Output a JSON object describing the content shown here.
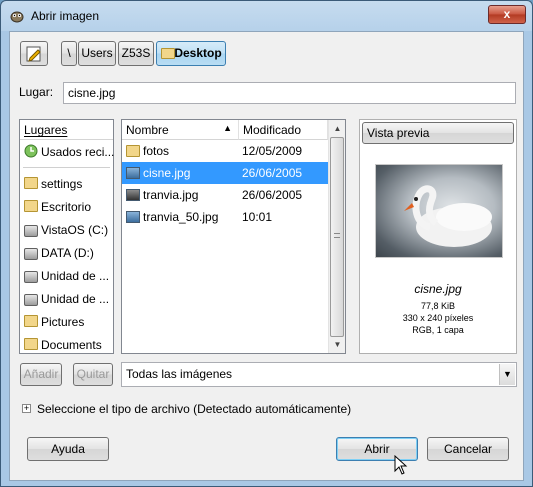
{
  "window": {
    "title": "Abrir imagen",
    "close_glyph": "x"
  },
  "pathbar": {
    "segments": [
      "\\",
      "Users",
      "Z53S",
      "Desktop"
    ]
  },
  "location": {
    "label": "Lugar:",
    "value": "cisne.jpg"
  },
  "places": {
    "header": "Lugares",
    "items": [
      {
        "label": "Usados reci...",
        "icon": "clock-icon"
      },
      {
        "label": "settings",
        "icon": "folder-icon"
      },
      {
        "label": "Escritorio",
        "icon": "folder-icon"
      },
      {
        "label": "VistaOS (C:)",
        "icon": "drive-icon"
      },
      {
        "label": "DATA (D:)",
        "icon": "drive-icon"
      },
      {
        "label": "Unidad de ...",
        "icon": "drive-icon"
      },
      {
        "label": "Unidad de ...",
        "icon": "drive-icon"
      },
      {
        "label": "Pictures",
        "icon": "folder-icon"
      },
      {
        "label": "Documents",
        "icon": "folder-icon"
      }
    ],
    "add_label": "Añadir",
    "remove_label": "Quitar"
  },
  "files": {
    "col_name": "Nombre",
    "sort_glyph": "▲",
    "col_modified": "Modificado",
    "rows": [
      {
        "name": "fotos",
        "date": "12/05/2009",
        "icon": "folder-icon"
      },
      {
        "name": "cisne.jpg",
        "date": "26/06/2005",
        "icon": "image-icon",
        "selected": true
      },
      {
        "name": "tranvia.jpg",
        "date": "26/06/2005",
        "icon": "image-icon"
      },
      {
        "name": "tranvia_50.jpg",
        "date": "10:01",
        "icon": "image-icon"
      }
    ]
  },
  "preview": {
    "button_label": "Vista previa",
    "filename": "cisne.jpg",
    "size": "77,8 KiB",
    "dimensions": "330 x 240 píxeles",
    "colorinfo": "RGB, 1 capa"
  },
  "filter": {
    "value": "Todas las imágenes"
  },
  "filetype": {
    "expander_glyph": "+",
    "label": "Seleccione el tipo de archivo (Detectado automáticamente)"
  },
  "buttons": {
    "help": "Ayuda",
    "open": "Abrir",
    "cancel": "Cancelar"
  }
}
